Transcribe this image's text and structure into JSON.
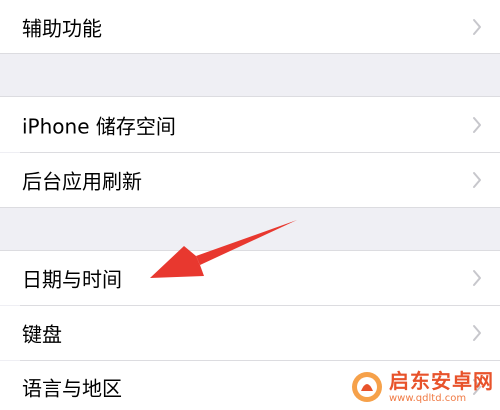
{
  "settings": {
    "items": [
      {
        "label": "辅助功能"
      },
      {
        "label": "iPhone 储存空间"
      },
      {
        "label": "后台应用刷新"
      },
      {
        "label": "日期与时间"
      },
      {
        "label": "键盘"
      },
      {
        "label": "语言与地区"
      }
    ]
  },
  "watermark": {
    "title": "启东安卓网",
    "url": "www.qdltd.com"
  },
  "colors": {
    "background": "#efeff4",
    "chevron": "#c7c7cc",
    "arrow": "#e8382f",
    "watermark": "#e8532b"
  }
}
